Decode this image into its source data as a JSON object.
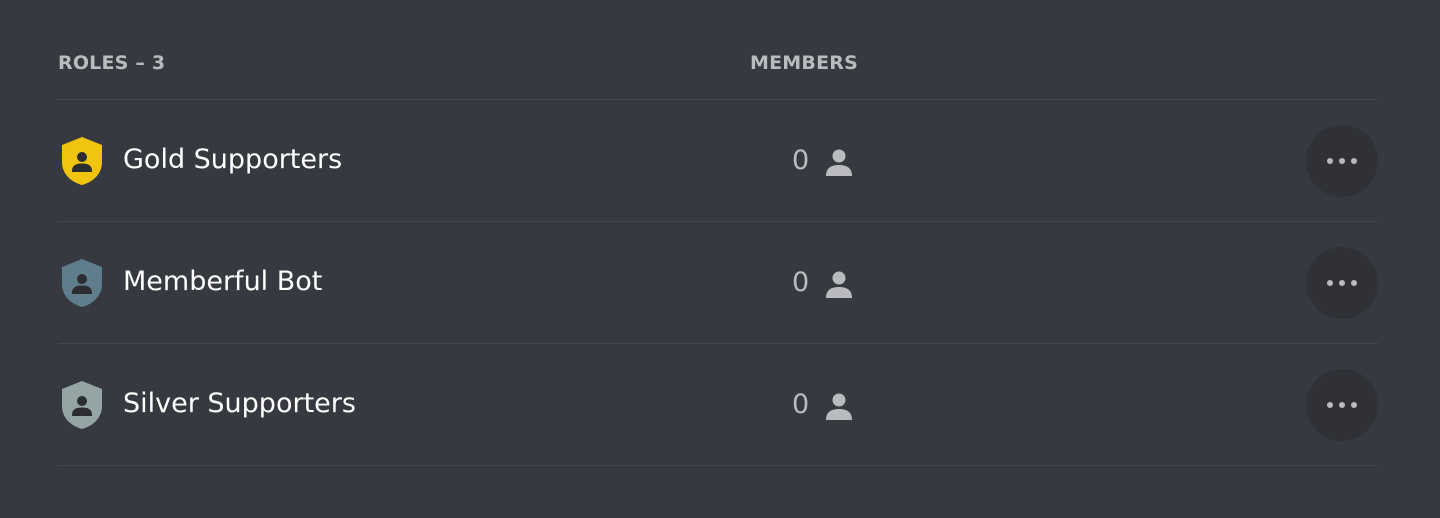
{
  "header": {
    "roles_label": "ROLES – 3",
    "members_label": "MEMBERS"
  },
  "roles": [
    {
      "name": "Gold Supporters",
      "members": "0",
      "color": "#f1c40f",
      "icon": "shield-person-icon"
    },
    {
      "name": "Memberful Bot",
      "members": "0",
      "color": "#607d8b",
      "icon": "shield-person-icon"
    },
    {
      "name": "Silver Supporters",
      "members": "0",
      "color": "#95a5a6",
      "icon": "shield-person-icon"
    }
  ],
  "colors": {
    "background": "#36393f",
    "divider": "#45484e",
    "header_text": "#b9bbbe",
    "role_text": "#ffffff",
    "count_text": "#b9bbbe",
    "more_button_bg": "#2f3136"
  },
  "icons": {
    "members": "person-icon",
    "more": "more-dots-icon"
  }
}
